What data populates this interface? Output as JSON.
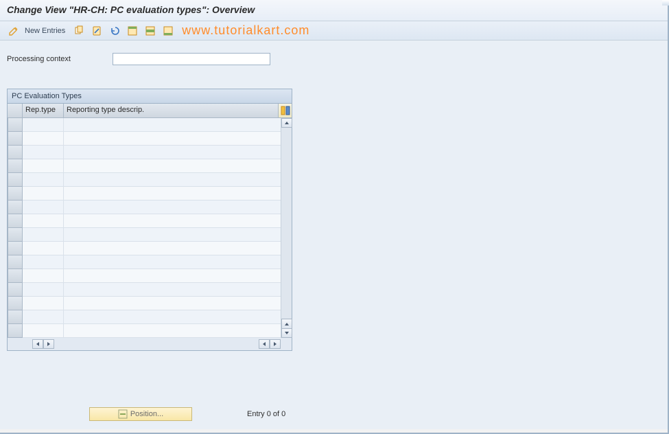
{
  "title": "Change View \"HR-CH: PC evaluation types\": Overview",
  "toolbar": {
    "new_entries_label": "New Entries"
  },
  "watermark": "www.tutorialkart.com",
  "form": {
    "processing_context_label": "Processing context",
    "processing_context_value": ""
  },
  "table": {
    "title": "PC Evaluation Types",
    "columns": {
      "rep_type": "Rep.type",
      "description": "Reporting type descrip."
    },
    "rows": [
      {
        "rep_type": "",
        "description": ""
      },
      {
        "rep_type": "",
        "description": ""
      },
      {
        "rep_type": "",
        "description": ""
      },
      {
        "rep_type": "",
        "description": ""
      },
      {
        "rep_type": "",
        "description": ""
      },
      {
        "rep_type": "",
        "description": ""
      },
      {
        "rep_type": "",
        "description": ""
      },
      {
        "rep_type": "",
        "description": ""
      },
      {
        "rep_type": "",
        "description": ""
      },
      {
        "rep_type": "",
        "description": ""
      },
      {
        "rep_type": "",
        "description": ""
      },
      {
        "rep_type": "",
        "description": ""
      },
      {
        "rep_type": "",
        "description": ""
      },
      {
        "rep_type": "",
        "description": ""
      },
      {
        "rep_type": "",
        "description": ""
      },
      {
        "rep_type": "",
        "description": ""
      }
    ]
  },
  "footer": {
    "position_label": "Position...",
    "entry_status": "Entry 0 of 0"
  }
}
